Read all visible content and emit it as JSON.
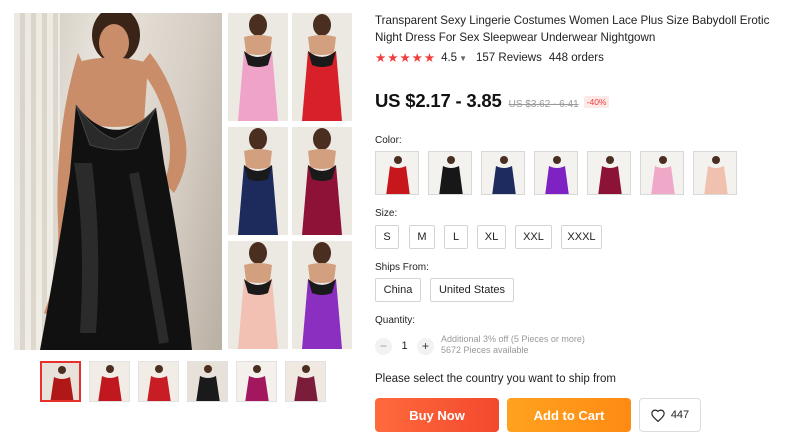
{
  "product": {
    "title": "Transparent Sexy Lingerie Costumes Women Lace Plus Size Babydoll Erotic Night Dress For Sex Sleepwear Underwear Nightgown",
    "rating": "4.5",
    "reviews": "157 Reviews",
    "orders": "448 orders",
    "price": "US $2.17 - 3.85",
    "original_price": "US $3.62 - 6.41",
    "discount": "-40%"
  },
  "gallery": {
    "grid_colors": [
      "#f0a3c9",
      "#d8202a",
      "#1c2a5c",
      "#8e1238",
      "#f3c1b3",
      "#8a2fc0"
    ],
    "thumb_colors": [
      "#b01818",
      "#c0181e",
      "#c81d25",
      "#1a1a1a",
      "#a3175f",
      "#7a1c3a"
    ]
  },
  "color_section": {
    "label": "Color:",
    "swatches": [
      {
        "name": "red",
        "hex": "#c8161d"
      },
      {
        "name": "black",
        "hex": "#171717"
      },
      {
        "name": "navy",
        "hex": "#1d2b5e"
      },
      {
        "name": "purple",
        "hex": "#7e22c4"
      },
      {
        "name": "wine",
        "hex": "#8c1236"
      },
      {
        "name": "pink",
        "hex": "#f0a8c8"
      },
      {
        "name": "nude",
        "hex": "#f1c1b0"
      }
    ]
  },
  "size_section": {
    "label": "Size:",
    "options": [
      "S",
      "M",
      "L",
      "XL",
      "XXL",
      "XXXL"
    ]
  },
  "ships_section": {
    "label": "Ships From:",
    "options": [
      "China",
      "United States"
    ]
  },
  "quantity": {
    "label": "Quantity:",
    "minus": "−",
    "value": "1",
    "plus": "+",
    "discount_note": "Additional 3% off (5 Pieces or more)",
    "available": "5672 Pieces available"
  },
  "shipping": {
    "message": "Please select the country you want to ship from"
  },
  "actions": {
    "buy_now": "Buy Now",
    "add_to_cart": "Add to Cart",
    "wishlist_count": "447"
  },
  "colors": {
    "star": "#f23d3d",
    "buy_now": "#f2492d",
    "add_to_cart": "#ff8a14",
    "discount_text": "#f23d3d"
  }
}
